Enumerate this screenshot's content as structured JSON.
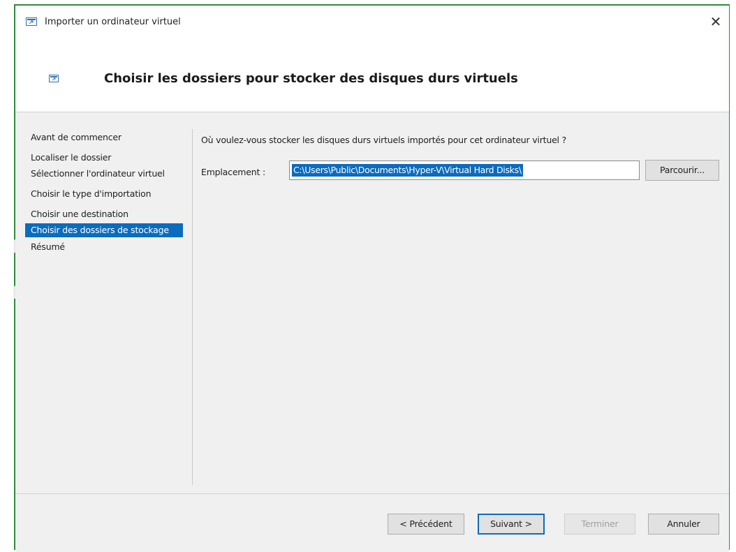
{
  "window": {
    "title": "Importer un ordinateur virtuel",
    "close_glyph": "✕",
    "icon": "vm-import-icon"
  },
  "header": {
    "title": "Choisir les dossiers pour stocker des disques durs virtuels",
    "icon": "vm-import-icon"
  },
  "sidebar": {
    "items": [
      {
        "label": "Avant de commencer",
        "active": false
      },
      {
        "label": "Localiser le dossier",
        "active": false
      },
      {
        "label": "Sélectionner l'ordinateur virtuel",
        "active": false
      },
      {
        "label": "Choisir le type d'importation",
        "active": false
      },
      {
        "label": "Choisir une destination",
        "active": false
      },
      {
        "label": "Choisir des dossiers de stockage",
        "active": true
      },
      {
        "label": "Résumé",
        "active": false
      }
    ]
  },
  "main": {
    "question": "Où voulez-vous stocker les disques durs virtuels importés pour cet ordinateur virtuel ?",
    "location_label": "Emplacement :",
    "location_value": "C:\\Users\\Public\\Documents\\Hyper-V\\Virtual Hard Disks\\",
    "browse_label": "Parcourir..."
  },
  "footer": {
    "prev_label": "< Précédent",
    "next_label": "Suivant >",
    "finish_label": "Terminer",
    "cancel_label": "Annuler"
  },
  "colors": {
    "accent": "#0b6cbd",
    "frame_border": "#2e8b3a"
  }
}
